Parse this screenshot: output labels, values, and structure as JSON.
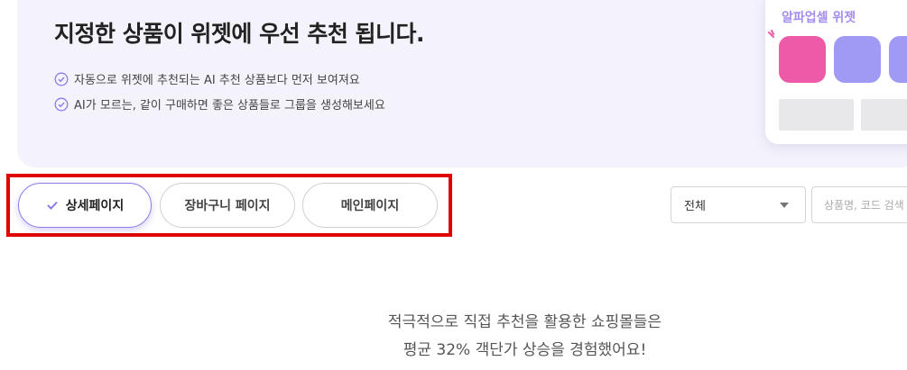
{
  "banner": {
    "headline": "지정한 상품이 위젯에 우선 추천 됩니다.",
    "points": [
      "자동으로 위젯에 추천되는 AI 추천 상품보다 먼저 보여져요",
      "AI가 모르는, 같이 구매하면 좋은 상품들로 그룹을 생성해보세요"
    ]
  },
  "preview": {
    "title": "알파업셀 위젯",
    "tile_colors": [
      "#ec5aa8",
      "#a09af5",
      "#a09af5"
    ]
  },
  "tabs": [
    {
      "label": "상세페이지",
      "selected": true
    },
    {
      "label": "장바구니 페이지",
      "selected": false
    },
    {
      "label": "메인페이지",
      "selected": false
    }
  ],
  "filter": {
    "selected": "전체"
  },
  "search": {
    "placeholder": "상품명, 코드 검색"
  },
  "promo": {
    "line1": "적극적으로 직접 추천을 활용한 쇼핑몰들은",
    "line2": "평균 32% 객단가 상승을 경험했어요!"
  },
  "colors": {
    "accent": "#8b7ce8",
    "highlight": "#e00000",
    "banner_bg": "#f4f3fb"
  }
}
